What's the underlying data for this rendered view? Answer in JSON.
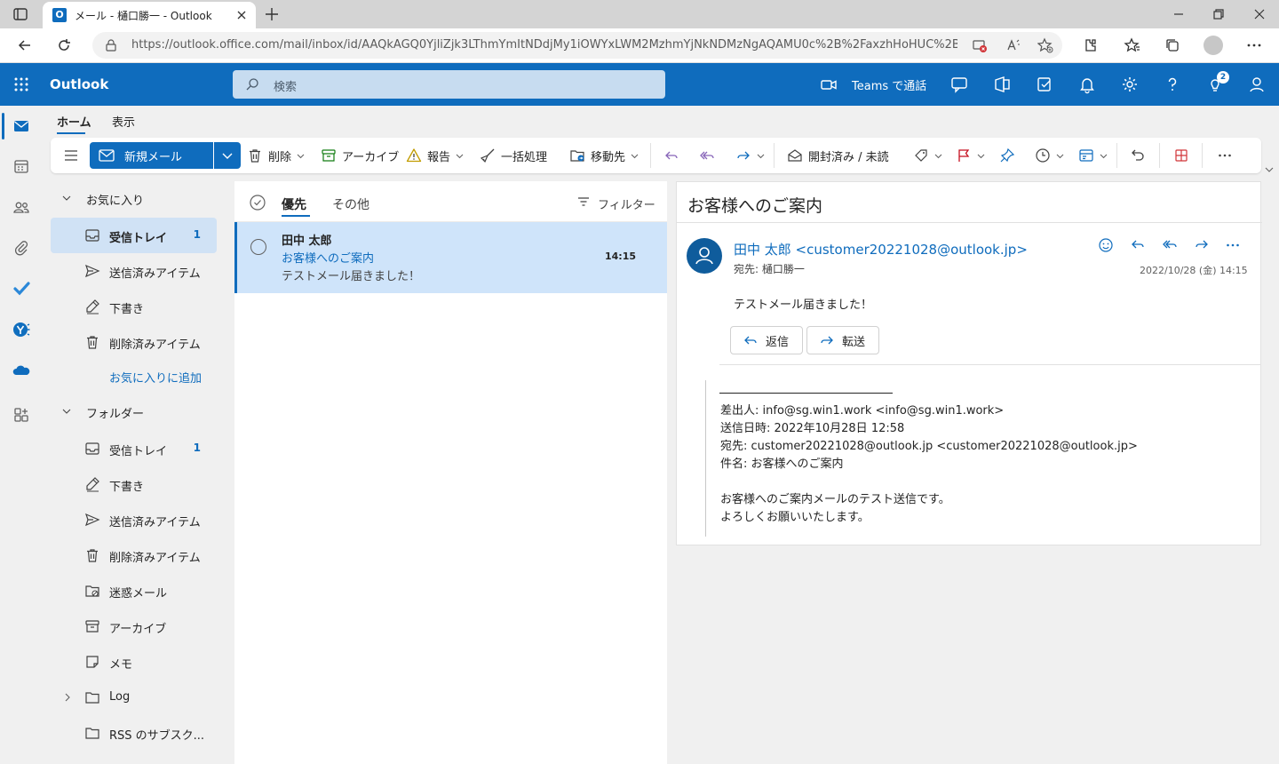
{
  "browser": {
    "tab_title": "メール - 樋口勝一 - Outlook",
    "url": "https://outlook.office.com/mail/inbox/id/AAQkAGQ0YjliZjk3LThmYmItNDdjMy1iOWYxLWM2MzhmYjNkNDMzNgAQAMU0c%2B%2FaxzhHoHUC%2B..."
  },
  "app": {
    "brand": "Outlook",
    "search_placeholder": "検索",
    "teams_label": "Teams で通話",
    "notification_count": "2",
    "accent_color": "#0f6cbd"
  },
  "ribbon": {
    "tabs": [
      "ホーム",
      "表示"
    ],
    "new_mail": "新規メール",
    "delete": "削除",
    "archive": "アーカイブ",
    "report": "報告",
    "sweep": "一括処理",
    "move_to": "移動先",
    "read_unread": "開封済み / 未読"
  },
  "folders": {
    "favorites_label": "お気に入り",
    "favorites": [
      {
        "label": "受信トレイ",
        "count": "1",
        "icon": "inbox-icon"
      },
      {
        "label": "送信済みアイテム",
        "count": "",
        "icon": "sent-icon"
      },
      {
        "label": "下書き",
        "count": "",
        "icon": "drafts-icon"
      },
      {
        "label": "削除済みアイテム",
        "count": "",
        "icon": "trash-icon"
      }
    ],
    "add_favorite": "お気に入りに追加",
    "folders_label": "フォルダー",
    "items": [
      {
        "label": "受信トレイ",
        "count": "1",
        "icon": "inbox-icon"
      },
      {
        "label": "下書き",
        "count": "",
        "icon": "drafts-icon"
      },
      {
        "label": "送信済みアイテム",
        "count": "",
        "icon": "sent-icon"
      },
      {
        "label": "削除済みアイテム",
        "count": "",
        "icon": "trash-icon"
      },
      {
        "label": "迷惑メール",
        "count": "",
        "icon": "junk-icon"
      },
      {
        "label": "アーカイブ",
        "count": "",
        "icon": "archive-icon"
      },
      {
        "label": "メモ",
        "count": "",
        "icon": "notes-icon"
      },
      {
        "label": "Log",
        "count": "",
        "icon": "folder-icon"
      },
      {
        "label": "RSS のサブスク...",
        "count": "",
        "icon": "folder-icon"
      }
    ]
  },
  "message_list": {
    "tabs": [
      "優先",
      "その他"
    ],
    "filter": "フィルター",
    "messages": [
      {
        "sender": "田中 太郎",
        "subject": "お客様へのご案内",
        "preview": "テストメール届きました！",
        "time": "14:15"
      }
    ]
  },
  "reading": {
    "title": "お客様へのご案内",
    "from": "田中 太郎 <customer20221028@outlook.jp>",
    "to": "宛先: 樋口勝一",
    "date": "2022/10/28 (金) 14:15",
    "body": "テストメール届きました！",
    "reply": "返信",
    "forward": "転送",
    "quoted": [
      "差出人: info@sg.win1.work <info@sg.win1.work>",
      "送信日時: 2022年10月28日 12:58",
      "宛先: customer20221028@outlook.jp <customer20221028@outlook.jp>",
      "件名: お客様へのご案内",
      "",
      "お客様へのご案内メールのテスト送信です。",
      "よろしくお願いいたします。"
    ]
  }
}
